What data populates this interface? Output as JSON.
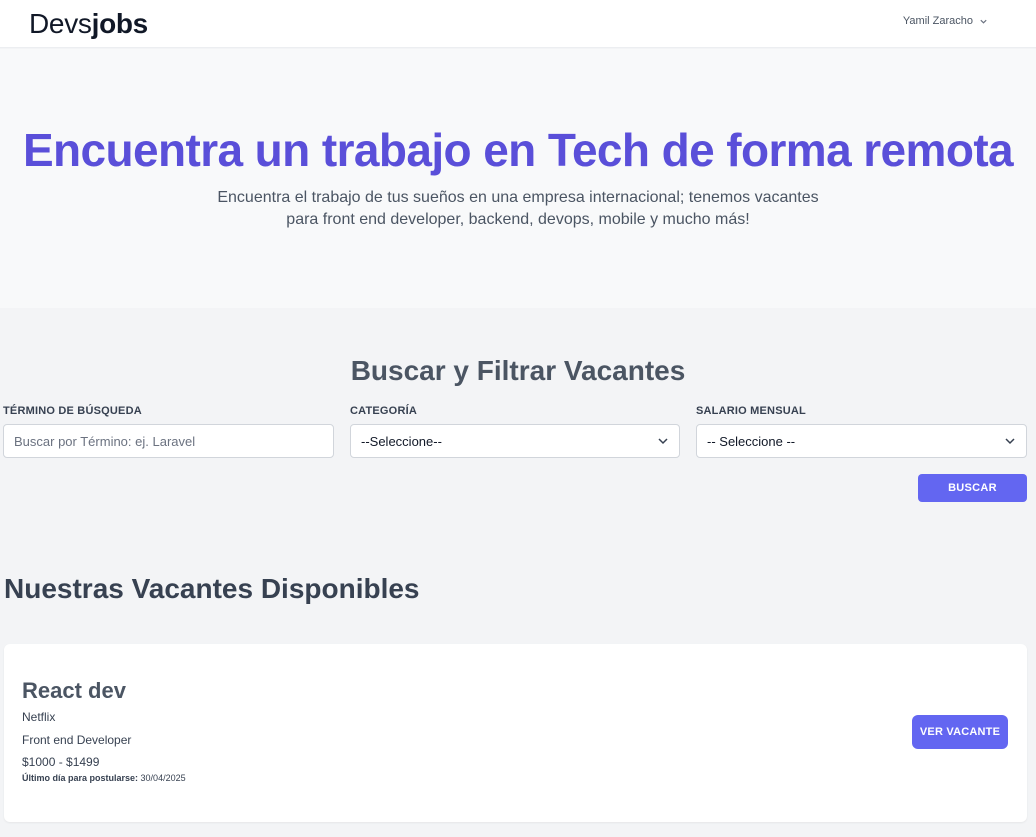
{
  "navbar": {
    "logo_light": "Devs",
    "logo_bold": "jobs",
    "user_name": "Yamil Zaracho"
  },
  "hero": {
    "title": "Encuentra un trabajo en Tech de forma remota",
    "subtitle_line1": "Encuentra el trabajo de tus sueños en una empresa internacional; tenemos vacantes",
    "subtitle_line2": "para front end developer, backend, devops, mobile y mucho más!"
  },
  "search": {
    "title": "Buscar y Filtrar Vacantes",
    "term_label": "TÉRMINO DE BÚSQUEDA",
    "term_placeholder": "Buscar por Término: ej. Laravel",
    "category_label": "CATEGORÍA",
    "category_selected": "--Seleccione--",
    "salary_label": "SALARIO MENSUAL",
    "salary_selected": "-- Seleccione --",
    "button_label": "BUSCAR"
  },
  "listings": {
    "title": "Nuestras Vacantes Disponibles",
    "jobs": [
      {
        "title": "React dev",
        "company": "Netflix",
        "category": "Front end Developer",
        "salary": "$1000 - $1499",
        "deadline_label": "Último día para postularse:",
        "deadline_value": "30/04/2025",
        "button_label": "VER VACANTE"
      }
    ]
  },
  "colors": {
    "accent": "#6366f1",
    "hero_title": "#5a4fd9"
  }
}
